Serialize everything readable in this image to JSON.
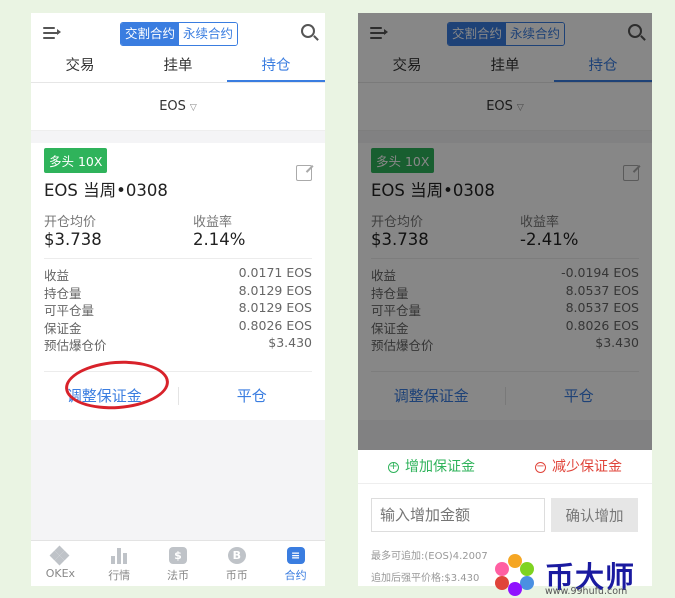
{
  "left": {
    "segment": [
      "交割合约",
      "永续合约"
    ],
    "tabs": [
      "交易",
      "挂单",
      "持仓"
    ],
    "instrument": "EOS",
    "badge": "多头 10X",
    "contract": "EOS 当周•0308",
    "avg_price_label": "开仓均价",
    "avg_price": "$3.738",
    "yield_label": "收益率",
    "yield": "2.14%",
    "rows": [
      {
        "k": "收益",
        "v": "0.0171 EOS"
      },
      {
        "k": "持仓量",
        "v": "8.0129 EOS"
      },
      {
        "k": "可平仓量",
        "v": "8.0129 EOS"
      },
      {
        "k": "保证金",
        "v": "0.8026 EOS"
      },
      {
        "k": "预估爆仓价",
        "v": "$3.430"
      }
    ],
    "adjust_margin": "调整保证金",
    "close_position": "平仓",
    "nav": [
      "OKEx",
      "行情",
      "法币",
      "币币",
      "合约"
    ]
  },
  "right": {
    "segment": [
      "交割合约",
      "永续合约"
    ],
    "tabs": [
      "交易",
      "挂单",
      "持仓"
    ],
    "instrument": "EOS",
    "badge": "多头 10X",
    "contract": "EOS 当周•0308",
    "avg_price_label": "开仓均价",
    "avg_price": "$3.738",
    "yield_label": "收益率",
    "yield": "-2.41%",
    "rows": [
      {
        "k": "收益",
        "v": "-0.0194 EOS"
      },
      {
        "k": "持仓量",
        "v": "8.0537 EOS"
      },
      {
        "k": "可平仓量",
        "v": "8.0537 EOS"
      },
      {
        "k": "保证金",
        "v": "0.8026 EOS"
      },
      {
        "k": "预估爆仓价",
        "v": "$3.430"
      }
    ],
    "adjust_margin": "调整保证金",
    "close_position": "平仓",
    "sheet": {
      "add_tab": "增加保证金",
      "reduce_tab": "减少保证金",
      "input_placeholder": "输入增加金额",
      "confirm": "确认增加",
      "max_add": "最多可追加:(EOS)4.2007",
      "liq_after": "追加后强平价格:$3.430"
    }
  },
  "watermark": {
    "text": "币大师",
    "url": "www.99hufu.com"
  },
  "colors": {
    "accent": "#3a7de0",
    "long_badge": "#2fb35b",
    "reduce": "#e0443a",
    "highlight_circle": "#d8222a"
  }
}
